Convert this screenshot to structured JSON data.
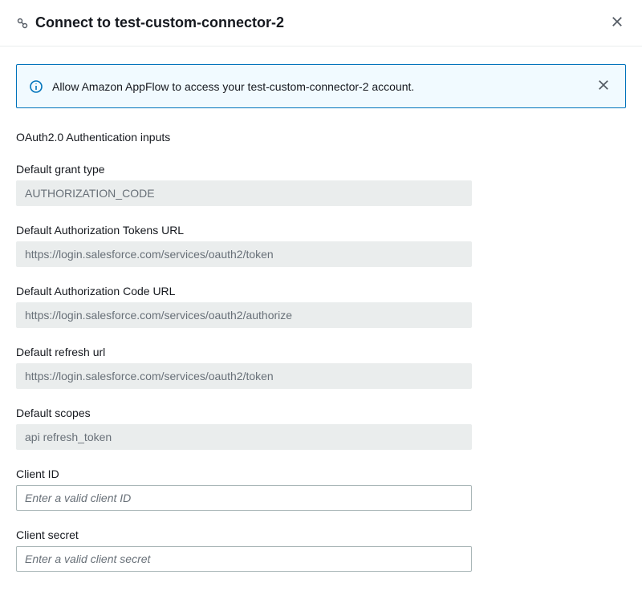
{
  "header": {
    "title": "Connect to test-custom-connector-2"
  },
  "alert": {
    "message": "Allow Amazon AppFlow to access your test-custom-connector-2 account."
  },
  "section": {
    "title": "OAuth2.0 Authentication inputs"
  },
  "fields": {
    "grantType": {
      "label": "Default grant type",
      "value": "AUTHORIZATION_CODE"
    },
    "tokensUrl": {
      "label": "Default Authorization Tokens URL",
      "value": "https://login.salesforce.com/services/oauth2/token"
    },
    "codeUrl": {
      "label": "Default Authorization Code URL",
      "value": "https://login.salesforce.com/services/oauth2/authorize"
    },
    "refreshUrl": {
      "label": "Default refresh url",
      "value": "https://login.salesforce.com/services/oauth2/token"
    },
    "scopes": {
      "label": "Default scopes",
      "value": "api refresh_token"
    },
    "clientId": {
      "label": "Client ID",
      "placeholder": "Enter a valid client ID"
    },
    "clientSecret": {
      "label": "Client secret",
      "placeholder": "Enter a valid client secret"
    }
  }
}
